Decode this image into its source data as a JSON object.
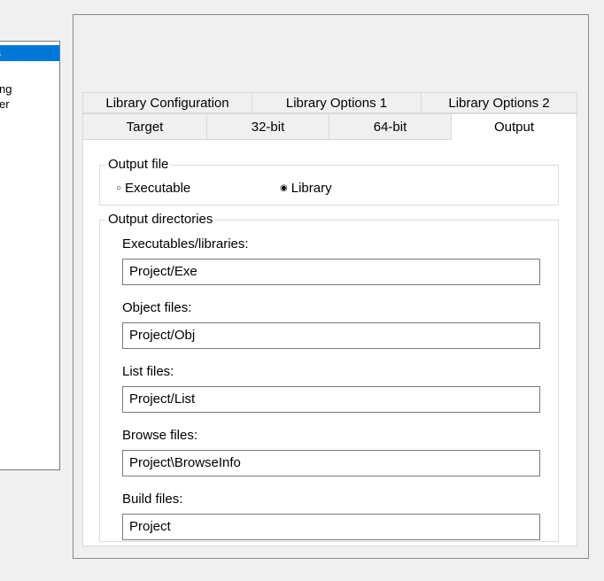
{
  "left_panel": {
    "selected_fragment": "s",
    "fragments": [
      "ng",
      "er"
    ]
  },
  "tabs": {
    "back_row": [
      "Library Configuration",
      "Library Options 1",
      "Library Options 2"
    ],
    "front_row": [
      "Target",
      "32-bit",
      "64-bit",
      "Output"
    ],
    "active": "Output"
  },
  "output_file": {
    "legend": "Output file",
    "options": [
      "Executable",
      "Library"
    ],
    "selected": "Library"
  },
  "output_directories": {
    "legend": "Output directories",
    "fields": [
      {
        "label": "Executables/libraries:",
        "value": "Project/Exe"
      },
      {
        "label": "Object files:",
        "value": "Project/Obj"
      },
      {
        "label": "List files:",
        "value": "Project/List"
      },
      {
        "label": "Browse files:",
        "value": "Project\\BrowseInfo"
      },
      {
        "label": "Build files:",
        "value": "Project"
      }
    ]
  },
  "colors": {
    "selection": "#0078d7",
    "background": "#f0f0f0"
  }
}
